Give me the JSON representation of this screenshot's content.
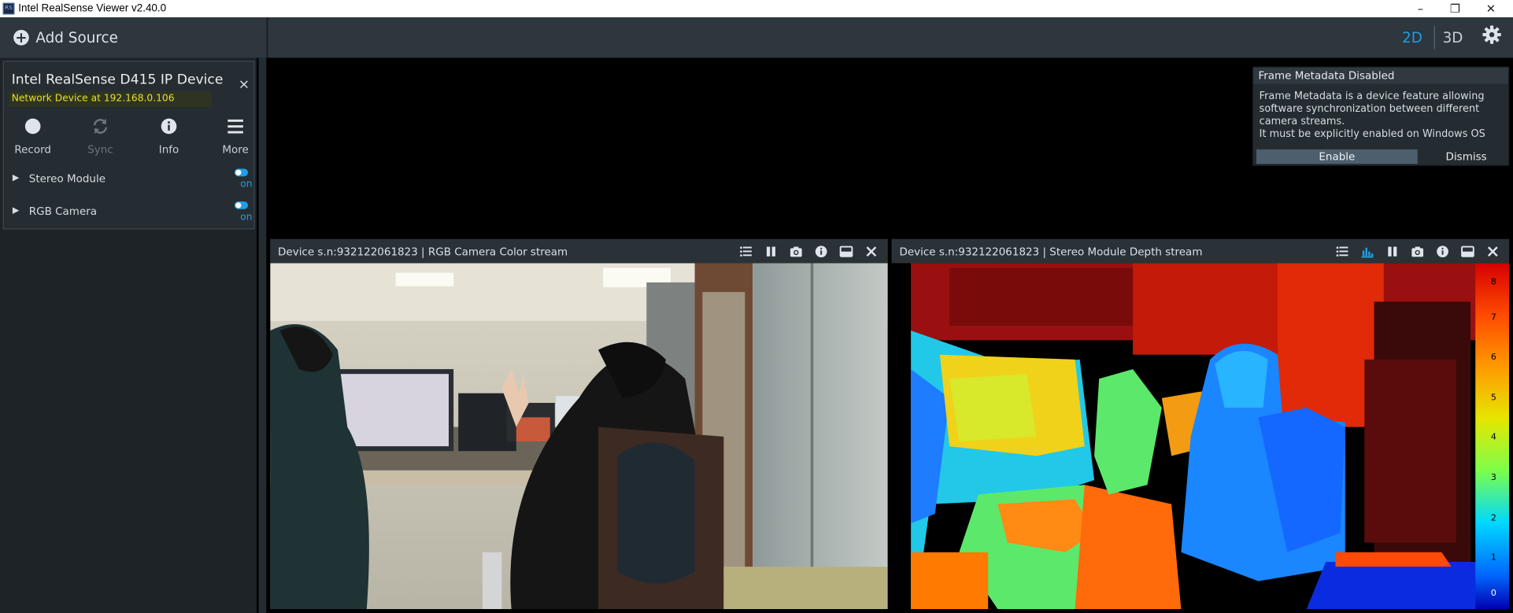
{
  "window": {
    "title": "Intel RealSense Viewer v2.40.0",
    "app_icon_text": "RS",
    "controls": {
      "minimize": "–",
      "maximize": "❐",
      "close": "✕"
    }
  },
  "toolbar": {
    "add_source_label": "Add Source",
    "add_icon": "+",
    "view_2d": "2D",
    "view_3d": "3D",
    "accent_color": "#1e9ee6"
  },
  "device": {
    "name": "Intel RealSense D415 IP Device",
    "address": "Network Device at 192.168.0.106",
    "close_symbol": "×",
    "buttons": [
      {
        "label": "Record",
        "icon": "record-icon",
        "enabled": true
      },
      {
        "label": "Sync",
        "icon": "sync-icon",
        "enabled": false
      },
      {
        "label": "Info",
        "icon": "info-icon",
        "enabled": true
      },
      {
        "label": "More",
        "icon": "menu-icon",
        "enabled": true
      }
    ],
    "modules": [
      {
        "arrow": "▶",
        "name": "Stereo Module",
        "state": "on"
      },
      {
        "arrow": "▶",
        "name": "RGB Camera",
        "state": "on"
      }
    ]
  },
  "notification": {
    "title": "Frame Metadata Disabled",
    "body": "Frame Metadata is a device feature allowing\nsoftware synchronization between different\ncamera streams.\nIt must be explicitly enabled on Windows OS",
    "enable_label": "Enable",
    "dismiss_label": "Dismiss"
  },
  "streams": [
    {
      "title": "Device s.n:932122061823 | RGB Camera Color stream",
      "icons": [
        "list-icon",
        "pause-icon",
        "camera-icon",
        "info-icon",
        "minimize-icon",
        "close-icon"
      ]
    },
    {
      "title": "Device s.n:932122061823 | Stereo Module Depth stream",
      "icons": [
        "list-icon",
        "histogram-icon",
        "pause-icon",
        "camera-icon",
        "info-icon",
        "minimize-icon",
        "close-icon"
      ]
    }
  ],
  "depth_colorbar": {
    "labels": [
      "8",
      "7",
      "6",
      "5",
      "4",
      "3",
      "2",
      "1",
      "0"
    ]
  }
}
